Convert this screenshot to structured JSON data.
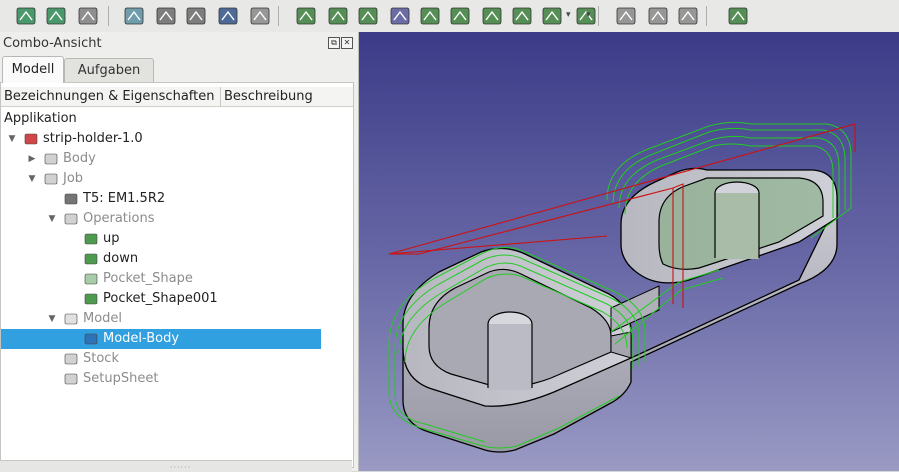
{
  "toolbar": {
    "icons": [
      "sketch-icon",
      "sketch-edit-icon",
      "face-icon",
      "path-job-icon",
      "path-postprocess-icon",
      "path-tools-icon",
      "path-stock-icon",
      "path-simulator-icon",
      "profile-icon",
      "pocket-icon",
      "pocket-shape-icon",
      "drilling-icon",
      "contour-icon",
      "engrave-icon",
      "helix-icon",
      "3d-pocket-icon",
      "adaptive-icon",
      "waterline-icon",
      "dressup-icon",
      "fixture-icon",
      "comment-icon",
      "stop-icon"
    ]
  },
  "combo": {
    "title": "Combo-Ansicht",
    "tabs": [
      {
        "label": "Modell",
        "active": true
      },
      {
        "label": "Aufgaben",
        "active": false
      }
    ],
    "columns": [
      "Bezeichnungen & Eigenschaften",
      "Beschreibung"
    ],
    "section": "Applikation",
    "tree": [
      {
        "label": "strip-holder-1.0",
        "depth": 0,
        "arrow": "down",
        "icon": "document-icon",
        "dim": false,
        "selected": false
      },
      {
        "label": "Body",
        "depth": 1,
        "arrow": "right",
        "icon": "body-icon",
        "dim": true,
        "selected": false
      },
      {
        "label": "Job",
        "depth": 1,
        "arrow": "down",
        "icon": "job-icon",
        "dim": true,
        "selected": false
      },
      {
        "label": "T5: EM1.5R2",
        "depth": 2,
        "arrow": "",
        "icon": "tool-bit-icon",
        "dim": false,
        "selected": false
      },
      {
        "label": "Operations",
        "depth": 2,
        "arrow": "down",
        "icon": "operations-icon",
        "dim": true,
        "selected": false
      },
      {
        "label": "up",
        "depth": 3,
        "arrow": "",
        "icon": "pocket-op-icon",
        "dim": false,
        "selected": false
      },
      {
        "label": "down",
        "depth": 3,
        "arrow": "",
        "icon": "pocket-op-icon",
        "dim": false,
        "selected": false
      },
      {
        "label": "Pocket_Shape",
        "depth": 3,
        "arrow": "",
        "icon": "pocket-shape-op-icon",
        "dim": true,
        "selected": false
      },
      {
        "label": "Pocket_Shape001",
        "depth": 3,
        "arrow": "",
        "icon": "pocket-shape-op-icon",
        "dim": false,
        "selected": false
      },
      {
        "label": "Model",
        "depth": 2,
        "arrow": "down",
        "icon": "folder-icon",
        "dim": true,
        "selected": false
      },
      {
        "label": "Model-Body",
        "depth": 3,
        "arrow": "",
        "icon": "model-body-icon",
        "dim": false,
        "selected": true
      },
      {
        "label": "Stock",
        "depth": 2,
        "arrow": "",
        "icon": "stock-icon",
        "dim": true,
        "selected": false
      },
      {
        "label": "SetupSheet",
        "depth": 2,
        "arrow": "",
        "icon": "setup-sheet-icon",
        "dim": true,
        "selected": false
      }
    ]
  },
  "colors": {
    "selection": "#30a0e0",
    "toolpath": "#22cc22",
    "rapid_move": "#cc1111",
    "view_top": "#3b3b88",
    "view_bottom": "#9a9ac4"
  }
}
